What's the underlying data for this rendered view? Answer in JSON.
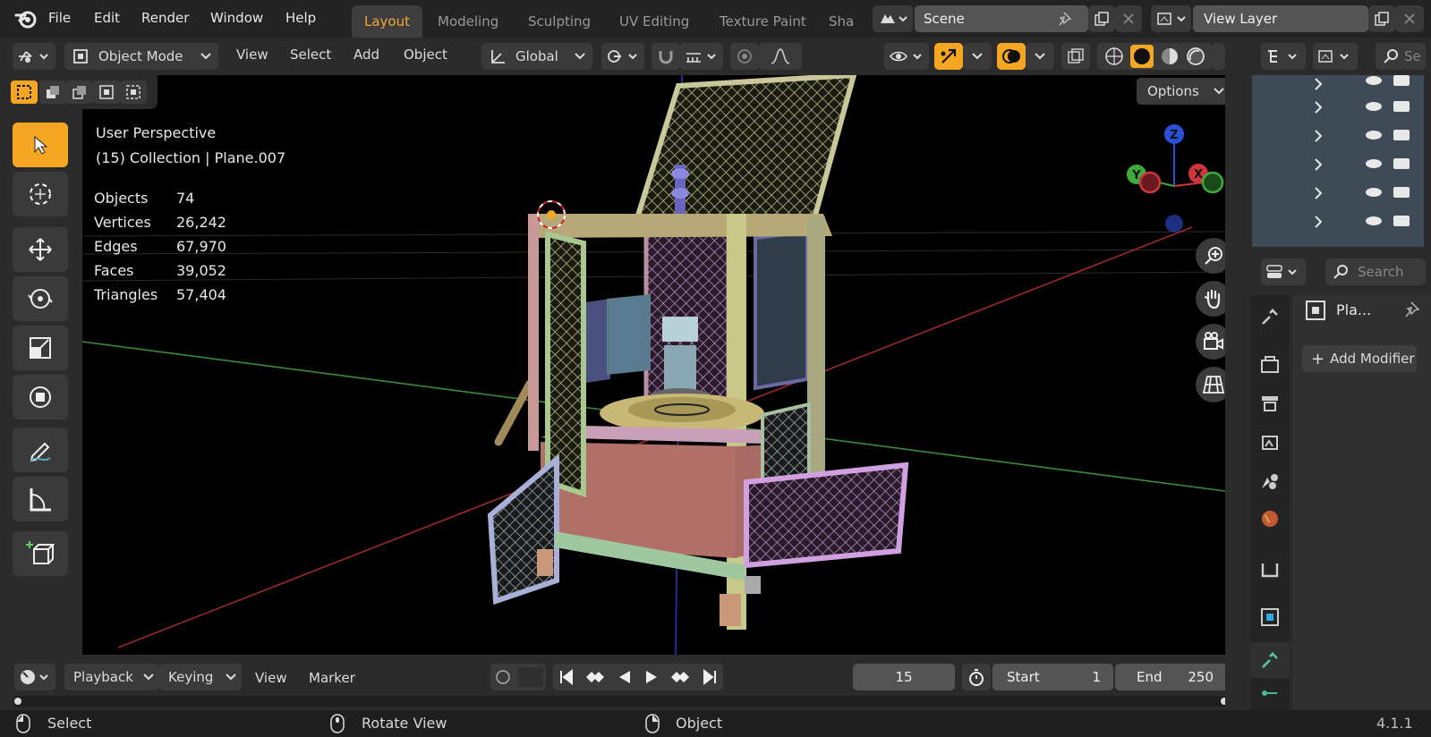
{
  "menu": [
    "File",
    "Edit",
    "Render",
    "Window",
    "Help"
  ],
  "workspaces": [
    "Layout",
    "Modeling",
    "Sculpting",
    "UV Editing",
    "Texture Paint",
    "Sha"
  ],
  "active_workspace": "Layout",
  "scene": {
    "name": "Scene"
  },
  "view_layer": {
    "name": "View Layer"
  },
  "viewport_header": {
    "mode": "Object Mode",
    "menus": [
      "View",
      "Select",
      "Add",
      "Object"
    ],
    "orientation": "Global",
    "options_label": "Options"
  },
  "overlay": {
    "perspective": "User Perspective",
    "collection": "(15) Collection | Plane.007",
    "stats": [
      {
        "label": "Objects",
        "value": "74"
      },
      {
        "label": "Vertices",
        "value": "26,242"
      },
      {
        "label": "Edges",
        "value": "67,970"
      },
      {
        "label": "Faces",
        "value": "39,052"
      },
      {
        "label": "Triangles",
        "value": "57,404"
      }
    ]
  },
  "gizmo": {
    "x": "X",
    "y": "Y",
    "z": "Z"
  },
  "timeline": {
    "menus": [
      "Playback",
      "Keying",
      "View",
      "Marker"
    ],
    "current_frame": "15",
    "start_label": "Start",
    "start_value": "1",
    "end_label": "End",
    "end_value": "250"
  },
  "properties": {
    "search_placeholder": "Search",
    "object_name": "Pla...",
    "add_modifier": "Add Modifier"
  },
  "outliner": {
    "search_placeholder": "Se"
  },
  "statusbar": {
    "select": "Select",
    "rotate": "Rotate View",
    "object": "Object",
    "version": "4.1.1"
  },
  "colors": {
    "accent": "#f5a623",
    "active_tab_text": "#f0a43a",
    "x_axis": "#d2343b",
    "y_axis": "#3cab3c",
    "z_axis": "#2a4fd8"
  }
}
